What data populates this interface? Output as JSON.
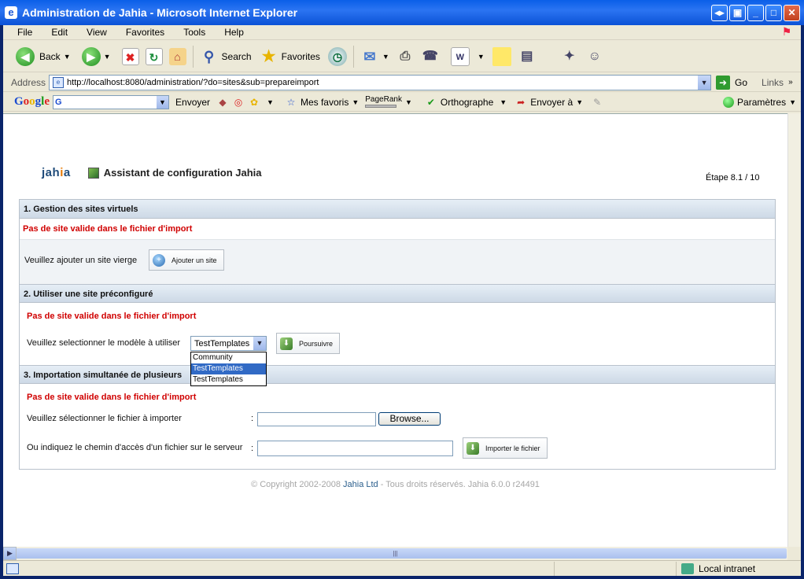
{
  "window": {
    "title": "Administration de Jahia - Microsoft Internet Explorer",
    "buttons": [
      "◂▸",
      "▣",
      "_",
      "□",
      "✕"
    ]
  },
  "menu": [
    "File",
    "Edit",
    "View",
    "Favorites",
    "Tools",
    "Help"
  ],
  "toolbar": {
    "back_label": "Back",
    "search_label": "Search",
    "favorites_label": "Favorites"
  },
  "address": {
    "label": "Address",
    "url": "http://localhost:8080/administration/?do=sites&sub=prepareimport",
    "go_label": "Go",
    "links_label": "Links"
  },
  "google_toolbar": {
    "logo": [
      "G",
      "o",
      "o",
      "g",
      "l",
      "e"
    ],
    "search_value": "G",
    "send_label": "Envoyer",
    "favorites_label": "Mes favoris",
    "pagerank_label": "PageRank",
    "spell_label": "Orthographe",
    "send_to_label": "Envoyer à",
    "settings_label": "Paramètres"
  },
  "page": {
    "brand_main": "jah",
    "brand_i": "i",
    "brand_end": "a",
    "wizard_title": "Assistant de configuration Jahia",
    "step": "Étape 8.1 / 10",
    "sections": {
      "s1": {
        "title": "1. Gestion des sites virtuels",
        "error": "Pas de site valide dans le fichier d'import",
        "prompt": "Veuillez ajouter un site vierge",
        "button": "Ajouter un site"
      },
      "s2": {
        "title": "2. Utiliser une site préconfiguré",
        "error": "Pas de site valide dans le fichier d'import",
        "prompt": "Veuillez selectionner le modèle à utiliser",
        "select_value": "TestTemplates",
        "options": [
          "Community",
          "TestTemplates",
          "TestTemplates"
        ],
        "button": "Poursuivre"
      },
      "s3": {
        "title": "3. Importation simultanée de plusieurs",
        "error": "Pas de site valide dans le fichier d'import",
        "file_prompt": "Veuillez sélectionner le fichier à importer",
        "colon": ":",
        "browse_label": "Browse...",
        "path_prompt": "Ou indiquez le chemin d'accès d'un fichier sur le serveur",
        "import_button": "Importer le fichier"
      }
    },
    "footer_pre": "© Copyright 2002-2008 ",
    "footer_link": "Jahia Ltd",
    "footer_post": " - Tous droits réservés. Jahia 6.0.0 r24491"
  },
  "status": {
    "zone": "Local intranet"
  }
}
